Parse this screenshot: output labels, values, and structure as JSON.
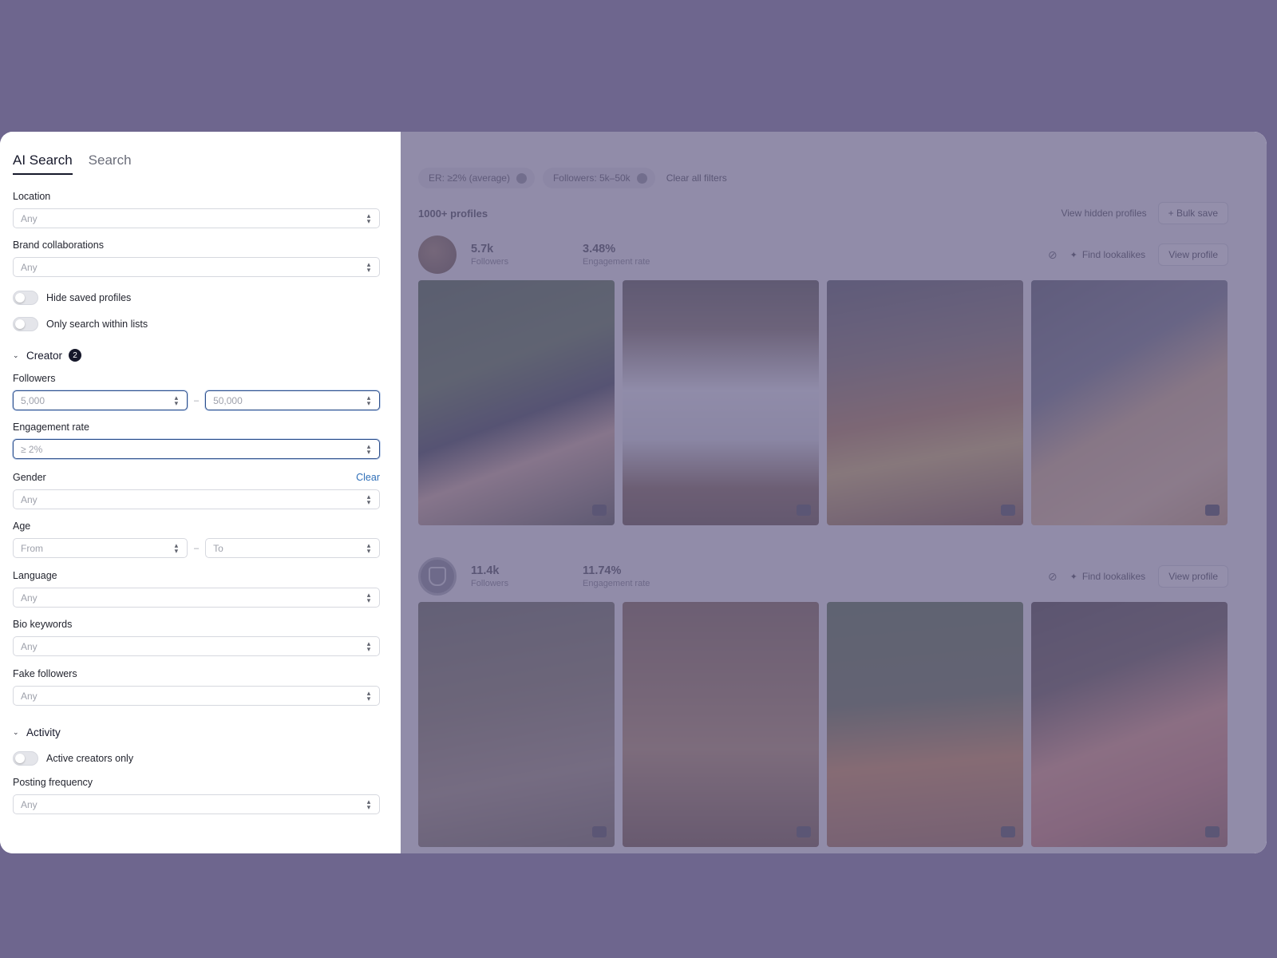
{
  "tabs": [
    "AI Search",
    "Search"
  ],
  "filters": {
    "location": {
      "label": "Location",
      "value": "Any"
    },
    "brand_collaborations": {
      "label": "Brand collaborations",
      "value": "Any"
    },
    "hide_saved": "Hide saved profiles",
    "only_lists": "Only search within lists",
    "creator_section": {
      "label": "Creator",
      "badge": "2"
    },
    "followers": {
      "label": "Followers",
      "from": "5,000",
      "to": "50,000"
    },
    "engagement_rate": {
      "label": "Engagement rate",
      "value": "≥ 2%"
    },
    "gender": {
      "label": "Gender",
      "value": "Any",
      "clear": "Clear"
    },
    "age": {
      "label": "Age",
      "from": "From",
      "to": "To"
    },
    "language": {
      "label": "Language",
      "value": "Any"
    },
    "bio_keywords": {
      "label": "Bio keywords",
      "value": "Any"
    },
    "fake_followers": {
      "label": "Fake followers",
      "value": "Any"
    },
    "activity_section": {
      "label": "Activity"
    },
    "active_only": "Active creators only",
    "posting_frequency": {
      "label": "Posting frequency",
      "value": "Any"
    },
    "range_dash": "–"
  },
  "chips": {
    "er": "ER: ≥2% (average)",
    "followers": "Followers: 5k–50k",
    "clear_all": "Clear all filters"
  },
  "results": {
    "count": "1000+ profiles",
    "view_hidden": "View hidden profiles",
    "bulk_save": "+ Bulk save"
  },
  "profiles": [
    {
      "followers": "5.7k",
      "followers_label": "Followers",
      "er": "3.48%",
      "er_label": "Engagement rate",
      "find": "Find lookalikes",
      "view": "View profile"
    },
    {
      "followers": "11.4k",
      "followers_label": "Followers",
      "er": "11.74%",
      "er_label": "Engagement rate",
      "find": "Find lookalikes",
      "view": "View profile"
    }
  ],
  "colors": {
    "backdrop": "#6e668e",
    "focus_border": "#2d4f8b",
    "link": "#2f6fb8"
  }
}
